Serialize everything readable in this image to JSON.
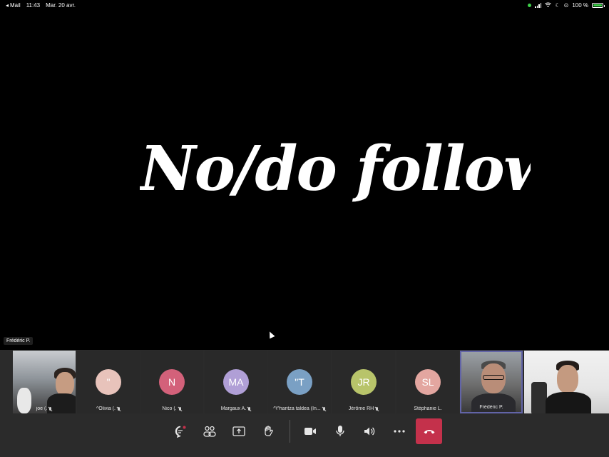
{
  "status_bar": {
    "back_app": "Mail",
    "time": "11:43",
    "date": "Mar. 20 avr.",
    "battery": "100 %"
  },
  "stage": {
    "slide_text": "No/do follow ?",
    "presenter_label": "Frédéric P."
  },
  "participants": [
    {
      "name": "joe (.",
      "initials": "",
      "avatar_color": "",
      "video": true
    },
    {
      "name": "^Olivia (.",
      "initials": "\"",
      "avatar_color": "#e8c3bb",
      "video": false
    },
    {
      "name": "Nico (.",
      "initials": "N",
      "avatar_color": "#d3617a",
      "video": false
    },
    {
      "name": "Margaux A.",
      "initials": "MA",
      "avatar_color": "#b09fd6",
      "video": false
    },
    {
      "name": "^\\^haritza taldea (In...",
      "initials": "\"T",
      "avatar_color": "#7aa0c4",
      "video": false
    },
    {
      "name": "Jérôme RH",
      "initials": "JR",
      "avatar_color": "#b8c46a",
      "video": false
    },
    {
      "name": "Stéphanie L.",
      "initials": "SL",
      "avatar_color": "#e3a6a0",
      "video": false
    },
    {
      "name": "Frédéric P.",
      "initials": "",
      "avatar_color": "",
      "video": true
    },
    {
      "name": "",
      "initials": "",
      "avatar_color": "",
      "video": true
    }
  ],
  "toolbar": {
    "accent": "#6264a7",
    "hangup_color": "#c4314b",
    "icons": [
      "chat-icon",
      "participants-icon",
      "share-screen-icon",
      "raise-hand-icon",
      "camera-icon",
      "microphone-icon",
      "speaker-icon",
      "more-icon",
      "hang-up-icon"
    ]
  }
}
